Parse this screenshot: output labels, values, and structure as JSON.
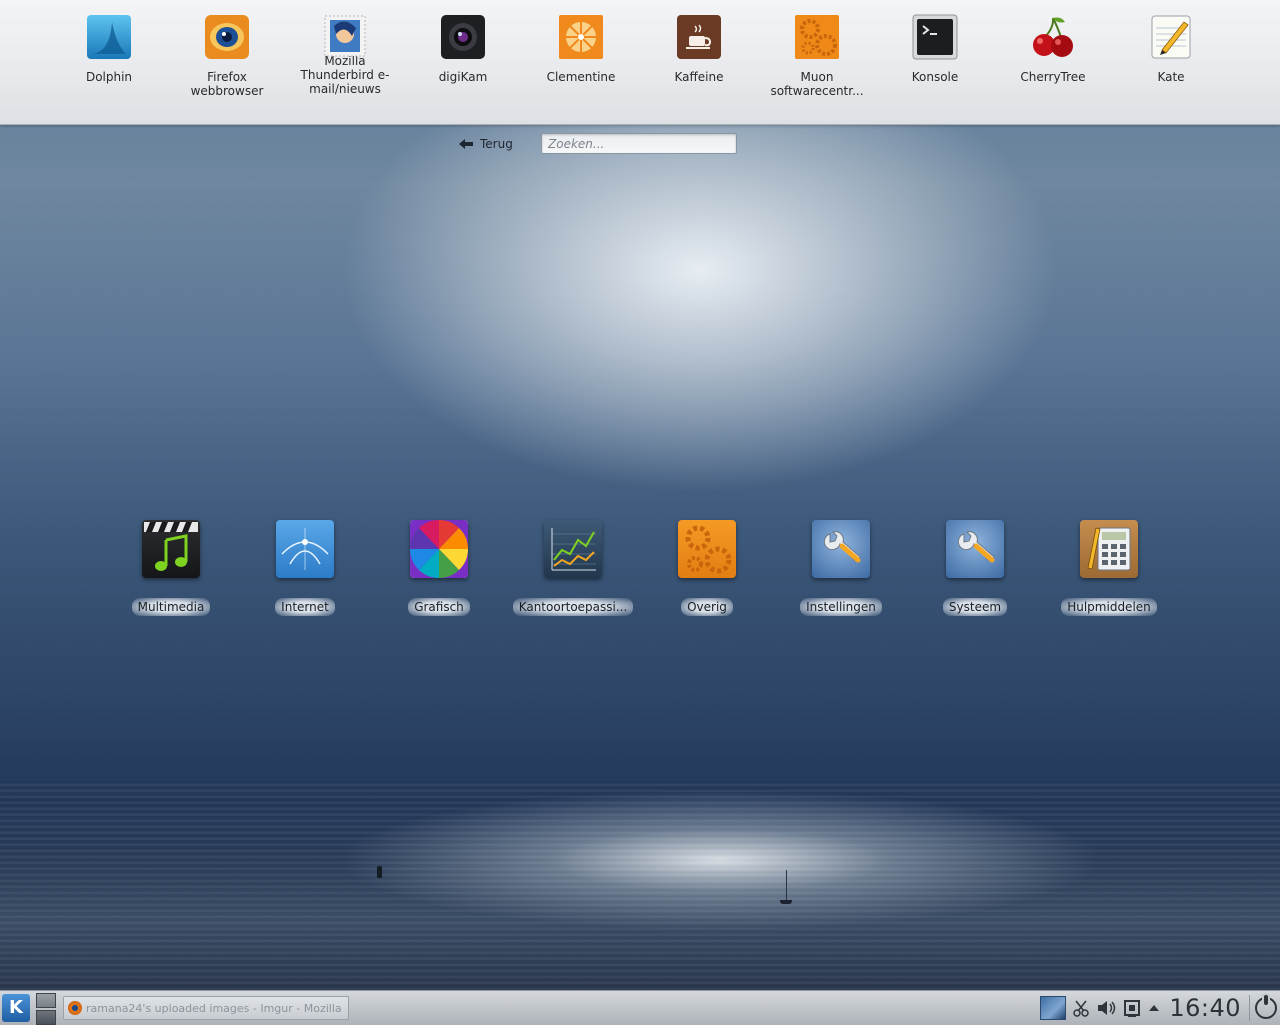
{
  "favorites": [
    {
      "name": "Dolphin",
      "icon": "dolphin-icon"
    },
    {
      "name": "Firefox webbrowser",
      "icon": "firefox-icon"
    },
    {
      "name": "Mozilla Thunderbird e-mail/nieuws",
      "icon": "thunderbird-icon"
    },
    {
      "name": "digiKam",
      "icon": "digikam-icon"
    },
    {
      "name": "Clementine",
      "icon": "clementine-icon"
    },
    {
      "name": "Kaffeine",
      "icon": "kaffeine-icon"
    },
    {
      "name": "Muon softwarecentr...",
      "icon": "muon-icon"
    },
    {
      "name": "Konsole",
      "icon": "konsole-icon"
    },
    {
      "name": "CherryTree",
      "icon": "cherrytree-icon"
    },
    {
      "name": "Kate",
      "icon": "kate-icon"
    }
  ],
  "nav": {
    "back_label": "Terug",
    "search_placeholder": "Zoeken..."
  },
  "categories": [
    {
      "name": "Multimedia",
      "icon": "multimedia-icon"
    },
    {
      "name": "Internet",
      "icon": "internet-icon"
    },
    {
      "name": "Grafisch",
      "icon": "graphics-icon"
    },
    {
      "name": "Kantoortoepassi...",
      "icon": "office-icon"
    },
    {
      "name": "Overig",
      "icon": "other-icon"
    },
    {
      "name": "Instellingen",
      "icon": "settings-icon"
    },
    {
      "name": "Systeem",
      "icon": "system-icon"
    },
    {
      "name": "Hulpmiddelen",
      "icon": "utilities-icon"
    }
  ],
  "taskbar": {
    "launcher_label": "K",
    "task_title": "ramana24's uploaded images - Imgur - Mozilla",
    "clock": "16:40"
  },
  "colors": {
    "panel_bg": "#e7e9ec",
    "taskbar_bg": "#c2c6cb",
    "accent": "#1f5ea3"
  }
}
